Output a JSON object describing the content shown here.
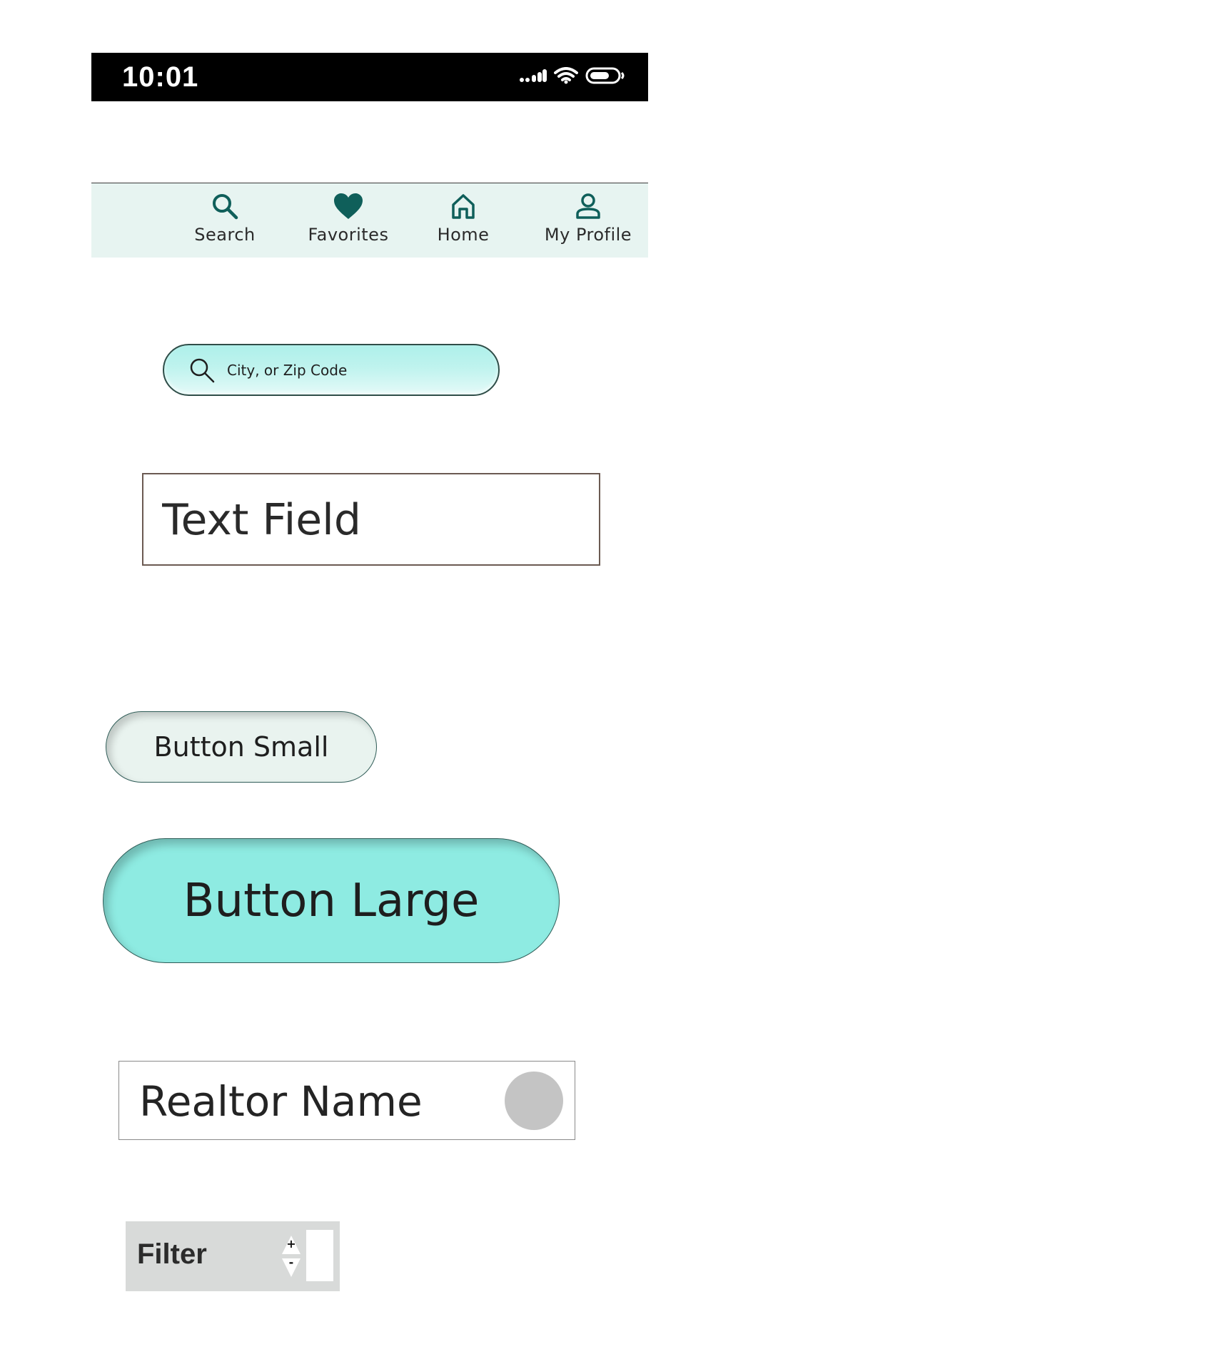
{
  "status_bar": {
    "time": "10:01",
    "icons": [
      "signal-icon",
      "wifi-icon",
      "battery-icon"
    ]
  },
  "nav": {
    "items": [
      {
        "label": "Search",
        "icon": "search-icon"
      },
      {
        "label": "Favorites",
        "icon": "heart-icon"
      },
      {
        "label": "Home",
        "icon": "home-icon"
      },
      {
        "label": "My Profile",
        "icon": "profile-icon"
      }
    ],
    "icon_color": "#0f5f5a",
    "background": "#e7f4f1"
  },
  "search": {
    "placeholder": "City, or Zip Code",
    "value": ""
  },
  "text_field": {
    "placeholder": "Text Field",
    "value": ""
  },
  "buttons": {
    "small_label": "Button Small",
    "large_label": "Button Large",
    "small_color": "#e9f3ef",
    "large_color": "#8eebe2"
  },
  "realtor": {
    "name": "Realtor Name",
    "avatar_color": "#c4c4c4"
  },
  "filter": {
    "label": "Filter",
    "increment": "+",
    "decrement": "-",
    "value": ""
  }
}
